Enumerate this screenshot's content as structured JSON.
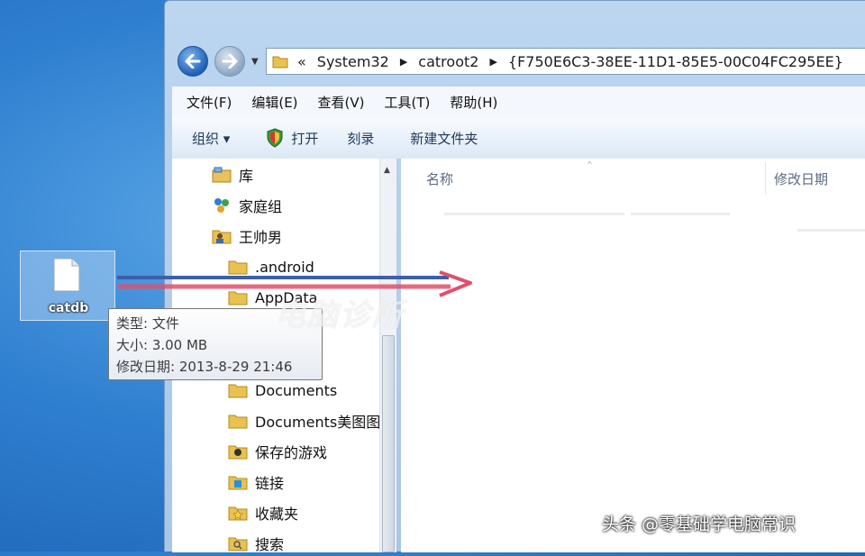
{
  "address_bar": {
    "overflow_marker": "«",
    "segments": [
      "System32",
      "catroot2",
      "{F750E6C3-38EE-11D1-85E5-00C04FC295EE}"
    ]
  },
  "menubar": {
    "items": [
      "文件(F)",
      "编辑(E)",
      "查看(V)",
      "工具(T)",
      "帮助(H)"
    ]
  },
  "toolbar": {
    "organize": "组织 ▾",
    "open": "打开",
    "burn": "刻录",
    "new_folder": "新建文件夹"
  },
  "nav_tree": [
    {
      "label": "库",
      "icon": "library-icon"
    },
    {
      "label": "家庭组",
      "icon": "homegroup-icon"
    },
    {
      "label": "王帅男",
      "icon": "user-folder-icon"
    },
    {
      "label": ".android",
      "icon": "folder-icon"
    },
    {
      "label": "AppData",
      "icon": "folder-icon"
    },
    {
      "label": "Documents",
      "icon": "folder-icon"
    },
    {
      "label": "Documents美图图",
      "icon": "folder-icon"
    },
    {
      "label": "保存的游戏",
      "icon": "saved-games-icon"
    },
    {
      "label": "链接",
      "icon": "links-icon"
    },
    {
      "label": "收藏夹",
      "icon": "favorites-icon"
    },
    {
      "label": "搜索",
      "icon": "search-folder-icon"
    }
  ],
  "file_list": {
    "columns": [
      "名称",
      "修改日期"
    ]
  },
  "desktop_file": {
    "name": "catdb"
  },
  "tooltip": {
    "type": "类型: 文件",
    "size": "大小: 3.00 MB",
    "modified": "修改日期: 2013-8-29 21:46"
  },
  "watermarks": {
    "center": "电脑诊所",
    "footer": "头条 @零基础学电脑常识"
  },
  "colors": {
    "desktop": "#2f7fd0",
    "window_frame": "#bcd6f0",
    "drag_arrow": "#e0506a"
  }
}
